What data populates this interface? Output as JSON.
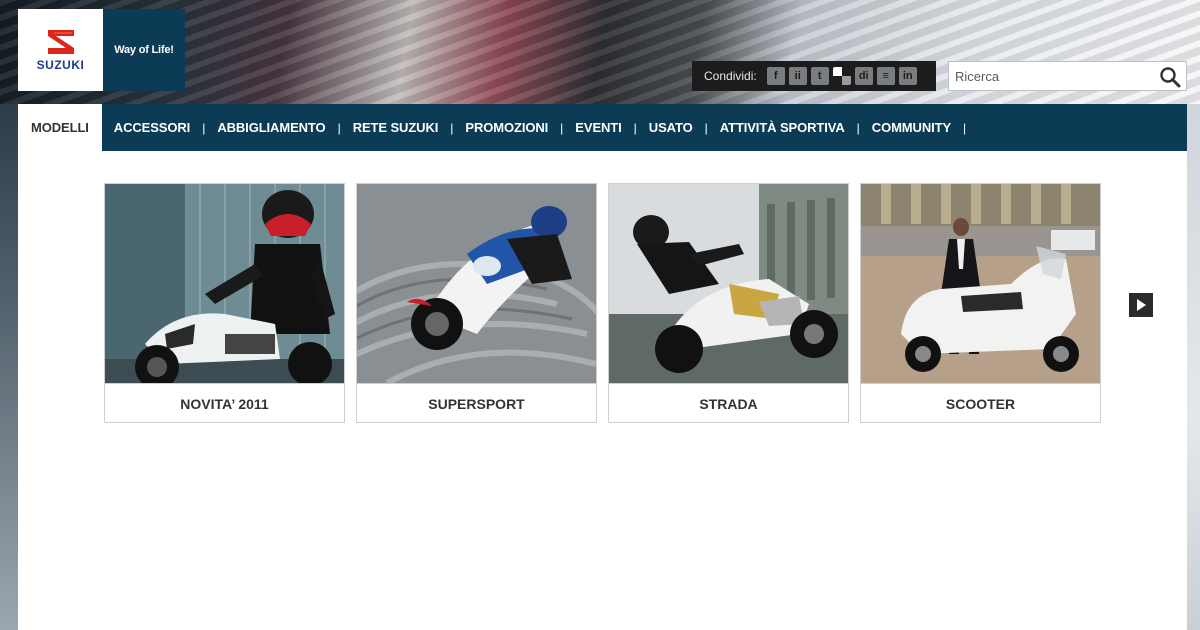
{
  "brand": {
    "logo_text": "SUZUKI",
    "tagline": "Way of Life!",
    "colors": {
      "nav_bg": "#0c3b56",
      "logo_red": "#d9261c",
      "logo_blue": "#1e3a8a"
    }
  },
  "share": {
    "label": "Condividi:",
    "icons": [
      {
        "name": "facebook-icon",
        "glyph": "f"
      },
      {
        "name": "myspace-icon",
        "glyph": "ii"
      },
      {
        "name": "twitter-icon",
        "glyph": "t"
      },
      {
        "name": "delicious-icon",
        "glyph": ""
      },
      {
        "name": "digg-icon",
        "glyph": "di"
      },
      {
        "name": "bookmark-icon",
        "glyph": "≡"
      },
      {
        "name": "linkedin-icon",
        "glyph": "in"
      }
    ]
  },
  "search": {
    "placeholder": "Ricerca",
    "value": "",
    "icon": "search-icon"
  },
  "nav": {
    "items": [
      {
        "label": "MODELLI",
        "active": true
      },
      {
        "label": "ACCESSORI",
        "active": false
      },
      {
        "label": "ABBIGLIAMENTO",
        "active": false
      },
      {
        "label": "RETE SUZUKI",
        "active": false
      },
      {
        "label": "PROMOZIONI",
        "active": false
      },
      {
        "label": "EVENTI",
        "active": false
      },
      {
        "label": "USATO",
        "active": false
      },
      {
        "label": "ATTIVITÀ SPORTIVA",
        "active": false
      },
      {
        "label": "COMMUNITY",
        "active": false
      }
    ]
  },
  "categories": [
    {
      "label": "NOVITA’ 2011",
      "image": "naked-bike-rider-photo"
    },
    {
      "label": "SUPERSPORT",
      "image": "sport-bike-cornering-photo"
    },
    {
      "label": "STRADA",
      "image": "street-bike-rider-photo"
    },
    {
      "label": "SCOOTER",
      "image": "maxi-scooter-photo"
    }
  ],
  "carousel": {
    "next_icon": "play-right-icon"
  }
}
